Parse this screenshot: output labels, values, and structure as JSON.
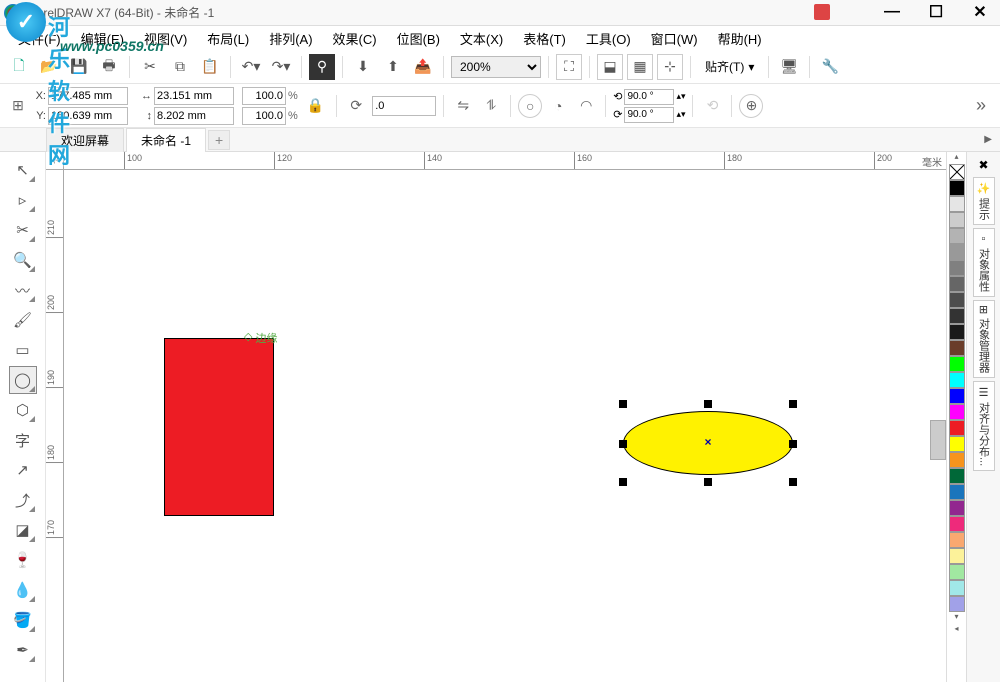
{
  "window": {
    "title": "CorelDRAW X7 (64-Bit) - 未命名 -1"
  },
  "watermark": {
    "site_name": "河乐软件网",
    "url": "www.pc0359.cn"
  },
  "menu": {
    "items": [
      "文件(F)",
      "编辑(E)",
      "视图(V)",
      "布局(L)",
      "排列(A)",
      "效果(C)",
      "位图(B)",
      "文本(X)",
      "表格(T)",
      "工具(O)",
      "窗口(W)",
      "帮助(H)"
    ]
  },
  "toolbar": {
    "zoom": "200%",
    "snap_label": "贴齐(T)"
  },
  "property_bar": {
    "x_label": "X:",
    "y_label": "Y:",
    "x": "177.485 mm",
    "y": "180.639 mm",
    "width": "23.151 mm",
    "height": "8.202 mm",
    "scale_x": "100.0",
    "scale_y": "100.0",
    "percent": "%",
    "rotation": ".0",
    "angle1": "90.0 °",
    "angle2": "90.0 °"
  },
  "tabs": {
    "welcome": "欢迎屏幕",
    "doc1": "未命名 -1"
  },
  "ruler": {
    "units": "毫米",
    "h_ticks": [
      "100",
      "120",
      "140",
      "160",
      "180",
      "200"
    ],
    "v_ticks": [
      "210",
      "200",
      "190",
      "180",
      "170"
    ]
  },
  "canvas": {
    "edge_label": "边缘"
  },
  "dockers": {
    "hints": "提示",
    "props": "对象属性",
    "manager": "对象管理器",
    "align": "对齐与分布..."
  },
  "colors": [
    "#ffffff",
    "#000000",
    "#d9d9d9",
    "#b3b3b3",
    "#8c8c8c",
    "#666666",
    "#404040",
    "#1a1a1a",
    "#00a651",
    "#00ffff",
    "#0000ff",
    "#ff00ff",
    "#ed1c24",
    "#ffff00",
    "#f7941d",
    "#8b4513",
    "#ffc0cb",
    "#9370db",
    "#90ee90",
    "#add8e6"
  ]
}
